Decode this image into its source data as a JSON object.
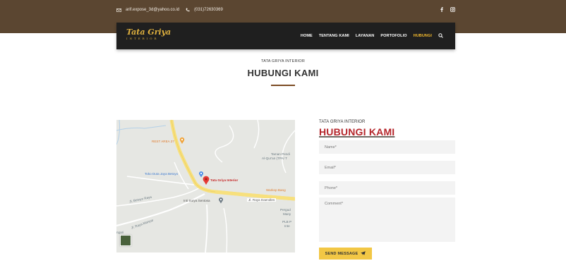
{
  "topbar": {
    "email": "arif.expose_3d@yahoo.co.id",
    "phone": "(031)72630369",
    "icons": [
      "mail-icon",
      "phone-icon",
      "facebook-icon",
      "instagram-icon"
    ]
  },
  "brand": {
    "name": "Tata Griya",
    "tagline": "INTERIOR",
    "color": "#e0b13e"
  },
  "nav": {
    "items": [
      {
        "label": "HOME",
        "active": false
      },
      {
        "label": "TENTANG KAMI",
        "active": false
      },
      {
        "label": "LAYANAN",
        "active": false
      },
      {
        "label": "PORTOFOLIO",
        "active": false
      },
      {
        "label": "HUBUNGI",
        "active": true
      }
    ],
    "active_color": "#f2b92d"
  },
  "heading": {
    "eyebrow": "TATA GRIYA INTERIOR",
    "title": "HUBUNGI KAMI"
  },
  "map": {
    "labels": {
      "rest_area": "REST AREA 27",
      "taman_1": "Taman Pendi",
      "taman_2": "Al-Qur'an (TPA/ T",
      "toko": "Toko Duta Jaya Betoyo",
      "tata_griya": "Tata Griya Interior",
      "warkop": "Warkop Bang",
      "jl_betoyo": "Jl. Betoyo Raya",
      "inti_surya": "Inti Surya Sentosa",
      "jl_raya_daendles": "Jl. Raya Daendles",
      "pergudangan_1": "Pergud",
      "pergudangan_2": "Many",
      "plb_1": "PLB P",
      "plb_2": "Inte",
      "jl_sw": "Jl. Raya Manyar",
      "left_edge": "ngari"
    }
  },
  "form": {
    "eyebrow": "TATA GRIYA INTERIOR",
    "title": "HUBUNGI KAMI",
    "name_placeholder": "Name*",
    "email_placeholder": "Email*",
    "phone_placeholder": "Phone*",
    "comment_placeholder": "Comment*",
    "submit_label": "SEND MESSAGE",
    "title_color": "#b5262b",
    "button_color": "#f2c745"
  }
}
